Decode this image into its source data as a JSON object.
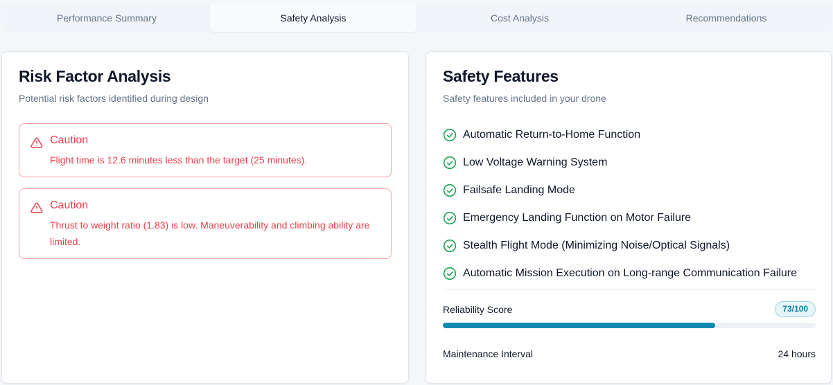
{
  "tabs": [
    {
      "label": "Performance Summary",
      "active": false
    },
    {
      "label": "Safety Analysis",
      "active": true
    },
    {
      "label": "Cost Analysis",
      "active": false
    },
    {
      "label": "Recommendations",
      "active": false
    }
  ],
  "risk": {
    "title": "Risk Factor Analysis",
    "subtitle": "Potential risk factors identified during design",
    "alerts": [
      {
        "icon": "warning-triangle-icon",
        "title": "Caution",
        "text": "Flight time is 12.6 minutes less than the target (25 minutes)."
      },
      {
        "icon": "warning-triangle-icon",
        "title": "Caution",
        "text": "Thrust to weight ratio (1.83) is low. Maneuverability and climbing ability are limited."
      }
    ]
  },
  "safety": {
    "title": "Safety Features",
    "subtitle": "Safety features included in your drone",
    "features": [
      "Automatic Return-to-Home Function",
      "Low Voltage Warning System",
      "Failsafe Landing Mode",
      "Emergency Landing Function on Motor Failure",
      "Stealth Flight Mode (Minimizing Noise/Optical Signals)",
      "Automatic Mission Execution on Long-range Communication Failure"
    ],
    "reliability_label": "Reliability Score",
    "reliability_badge": "73/100",
    "reliability_value": 73,
    "maintenance_label": "Maintenance Interval",
    "maintenance_value": "24 hours"
  },
  "colors": {
    "caution": "#ef3e4a",
    "check": "#22a55a",
    "progress": "#0b89b0"
  }
}
